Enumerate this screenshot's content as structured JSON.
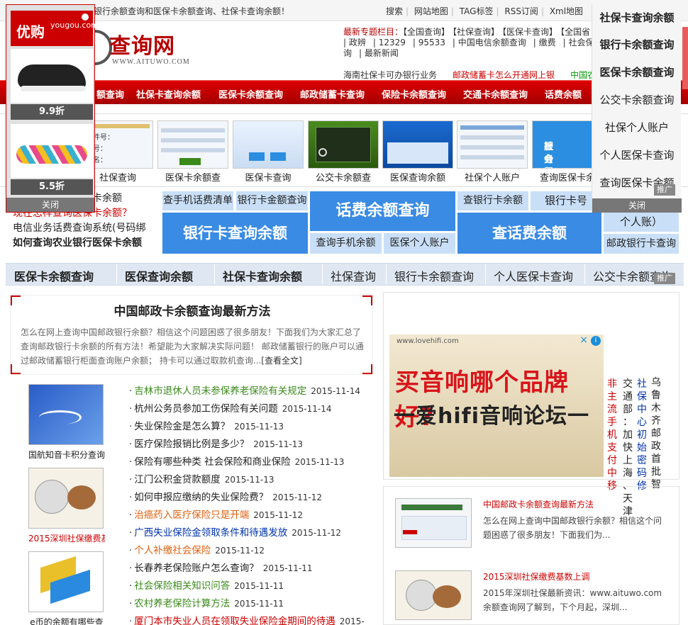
{
  "topbar": {
    "welcome": "银行余额查询和医保卡余额查询、社保卡查询余额！",
    "links": [
      "搜索",
      "网站地图",
      "TAG标签",
      "RSS订阅",
      "Xml地图"
    ],
    "extra": "【 设"
  },
  "logo": {
    "name": "查询网",
    "url": "WWW.AITUWO.COM"
  },
  "header": {
    "topic_label": "最新专题栏目：",
    "topic_links": [
      "【全国查询】",
      "【社保查询】",
      "【医保卡查询】",
      "【全国省"
    ],
    "row2": [
      "| 政辨",
      "| 12329",
      "| 95533",
      "| 中国电信余额查询",
      "| 缴费",
      "| 社会保险"
    ],
    "row3": [
      "询",
      "| 最新新闻"
    ],
    "hotline": [
      {
        "text": "海南社保卡可办银行业务",
        "color": "c1"
      },
      {
        "text": "邮政储蓄卡怎么开通网上银",
        "color": "c2"
      },
      {
        "text": "中国农业",
        "color": "c3"
      }
    ]
  },
  "mainnav": [
    "额查询",
    "社保卡查询余额",
    "医保卡余额查询",
    "邮政储蓄卡查询",
    "保险卡余额查询",
    "交通卡余额查询",
    "话费余额"
  ],
  "thumbs": [
    {
      "label": "社保查询"
    },
    {
      "label": "医保卡余额查"
    },
    {
      "label": "医保卡查询"
    },
    {
      "label": "公交卡余额查"
    },
    {
      "label": "医保查询余额"
    },
    {
      "label": "社保个人账户"
    },
    {
      "label": "查询医保卡余"
    }
  ],
  "thumb_text": {
    "form1": [
      "证件号：",
      "证号：",
      "姓名："
    ],
    "panel": [
      "社会保障卡",
      "服务平台"
    ]
  },
  "tags_left": [
    "如何网上查询医保卡余额",
    "现在怎样查询医保卡余额？",
    "电信业务话费查询系统(号码绑",
    "如何查询农业银行医保卡余额"
  ],
  "tiles": {
    "t1": "查手机话费清单",
    "t2": "银行卡金额查询",
    "t3": "话费余额查询",
    "t4": "查银行卡余额",
    "t5": "银行卡号",
    "t6": "银行卡查询余额",
    "t7": "查询手机余额",
    "t8": "医保个人账户",
    "t9": "查话费余额",
    "t10": "个人账）",
    "t11": "邮政银行卡查询"
  },
  "tabs": [
    "医保卡余额查询",
    "医保查询余额",
    "社保卡查询余额",
    "社保查询",
    "银行卡余额查询",
    "个人医保卡查询",
    "公交卡余额查询"
  ],
  "feature": {
    "title": "中国邮政卡余额查询最新方法",
    "desc": "怎么在网上查询中国邮政银行余额？相信这个问题困惑了很多朋友！下面我们为大家汇总了查询邮政银行卡余额的所有方法！希望能为大家解决实际问题！ 邮政储蓄银行的账户可以通过邮政储蓄银行柜面查询账户余额； 持卡可以通过取款机查询...",
    "more": "[查看全文]"
  },
  "sidepics": [
    {
      "label": "国航知音卡积分查询",
      "red": false
    },
    {
      "label": "2015深圳社保缴费基",
      "red": true
    },
    {
      "label": "e币的余额有哪些查",
      "red": false
    }
  ],
  "news": [
    {
      "title": "吉林市退休人员未参保养老保险有关规定",
      "date": "2015-11-14",
      "color": "green"
    },
    {
      "title": "杭州公务员参加工伤保险有关问题",
      "date": "2015-11-14",
      "color": "dark"
    },
    {
      "title": "失业保险金是怎么算？",
      "date": "2015-11-13",
      "color": "dark"
    },
    {
      "title": "医疗保险报销比例是多少？",
      "date": "2015-11-13",
      "color": "dark"
    },
    {
      "title": "保险有哪些种类 社会保险和商业保险",
      "date": "2015-11-13",
      "color": "dark"
    },
    {
      "title": "江门公积金贷款额度",
      "date": "2015-11-13",
      "color": "dark"
    },
    {
      "title": "如何申报应缴纳的失业保险费？",
      "date": "2015-11-12",
      "color": "dark"
    },
    {
      "title": "治癌药入医疗保险只是开端",
      "date": "2015-11-12",
      "color": "orange"
    },
    {
      "title": "广西失业保险金领取条件和待遇发放",
      "date": "2015-11-12",
      "color": "blue"
    },
    {
      "title": "个人补缴社会保险",
      "date": "2015-11-12",
      "color": "orange"
    },
    {
      "title": "长春养老保险账户怎么查询？",
      "date": "2015-11-11",
      "color": "dark"
    },
    {
      "title": "社会保险相关知识问答",
      "date": "2015-11-11",
      "color": "green"
    },
    {
      "title": "农村养老保险计算方法",
      "date": "2015-11-11",
      "color": "green"
    },
    {
      "title": "厦门本市失业人员在领取失业保险金期间的待遇",
      "date": "2015-",
      "color": "red"
    }
  ],
  "ad": {
    "url": "www.lovehifi.com",
    "line1": "买音响哪个品牌好?",
    "line2": "一爱hifi音响论坛一",
    "info": "i",
    "close": "×"
  },
  "vertical_cols": [
    {
      "text": "非主流手机支付中移",
      "color": "red"
    },
    {
      "text": "交通部：加快上海、天津",
      "color": "blk"
    },
    {
      "text": "社保中心初始密码修",
      "color": "blu"
    },
    {
      "text": "乌鲁木齐邮政首批智",
      "color": "blk"
    }
  ],
  "right_items": [
    {
      "title": "中国邮政卡余额查询最新方法",
      "desc": "怎么在网上查询中国邮政银行余额？相信这个问题困惑了很多朋友！下面我们为..."
    },
    {
      "title": "2015深圳社保缴费基数上调",
      "desc": "2015年深圳社保最新资讯：www.aituwo.com余额查询网了解到，下个月起，深圳..."
    }
  ],
  "float_left": {
    "brand": "优购",
    "brand_sub": "yougou.com",
    "prices": [
      "9.9折",
      "5.5折"
    ],
    "close": "关闭"
  },
  "float_right": {
    "items": [
      {
        "text": "社保卡查询余额",
        "bold": true
      },
      {
        "text": "银行卡余额查询",
        "bold": true
      },
      {
        "text": "医保卡余额查询",
        "bold": true
      },
      {
        "text": "公交卡余额查询",
        "bold": false
      },
      {
        "text": "社保个人账户",
        "bold": false
      },
      {
        "text": "个人医保卡查询",
        "bold": false
      },
      {
        "text": "查询医保卡余额",
        "bold": false
      }
    ],
    "close": "关闭"
  },
  "push_label": "推广",
  "colors": {
    "brand_red": "#b60000",
    "nav_red": "#c00000",
    "tile_light": "#c9dff7",
    "tile_dark": "#3a8be3"
  }
}
